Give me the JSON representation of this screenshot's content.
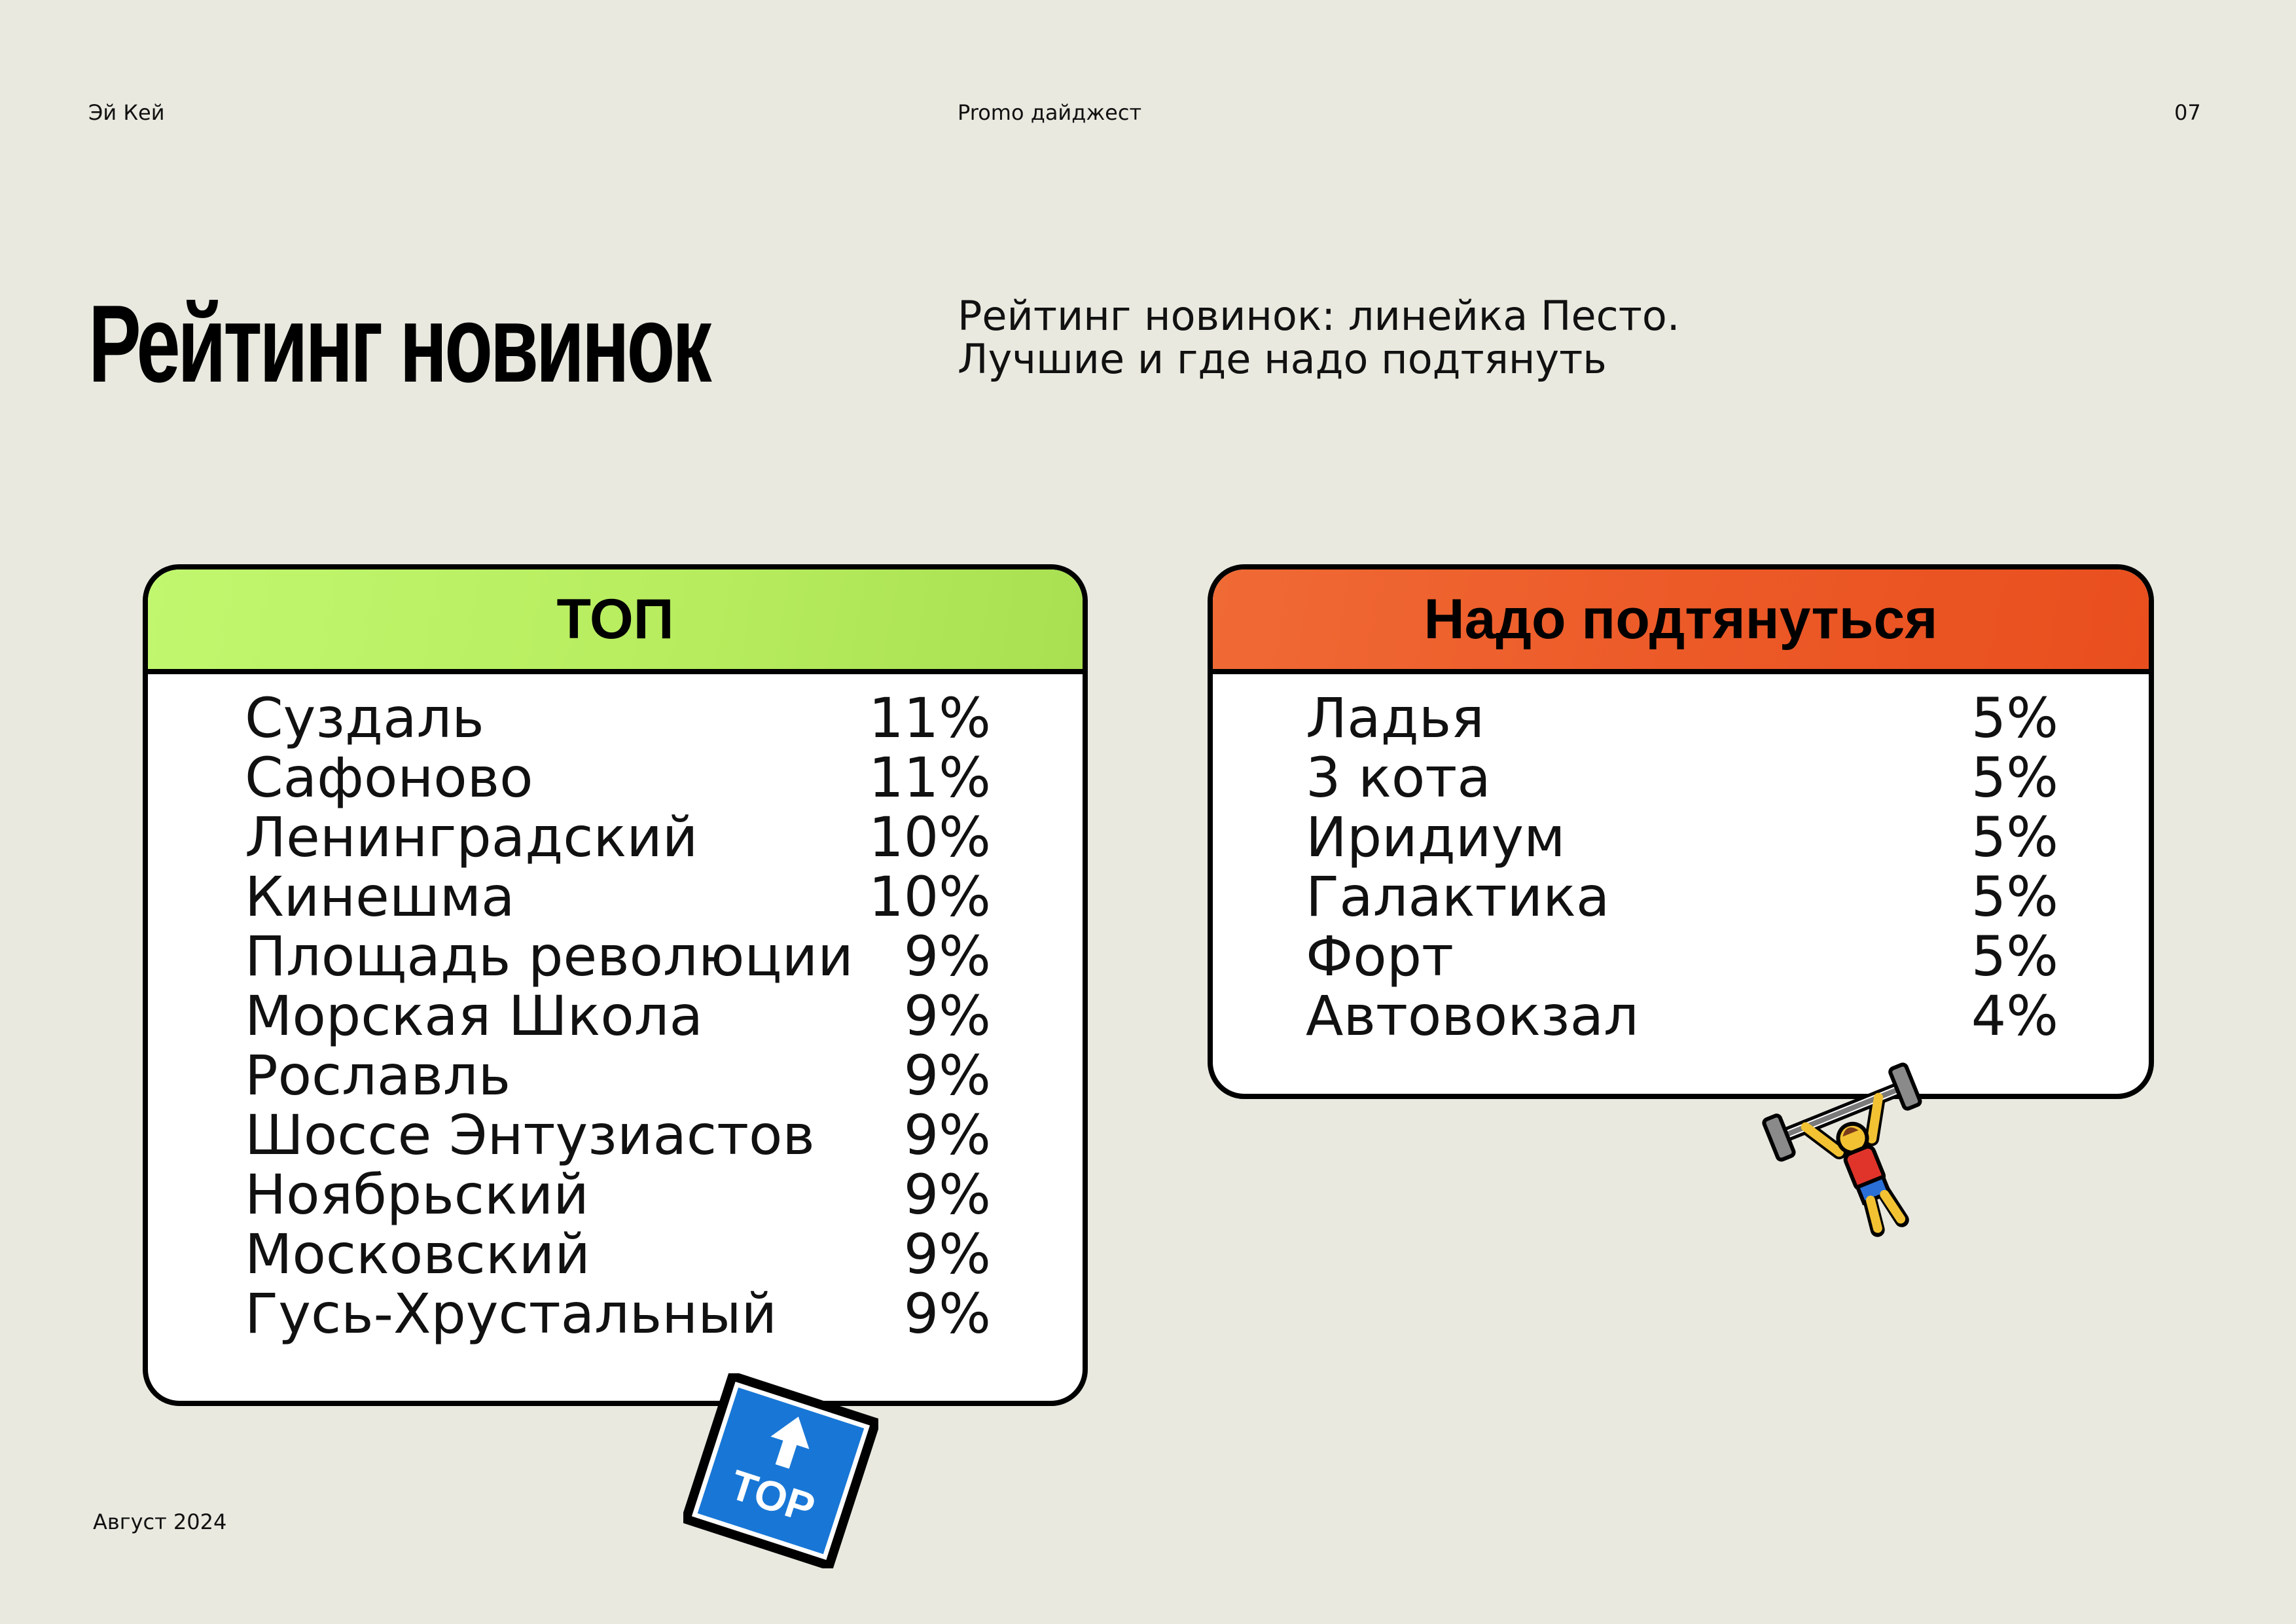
{
  "header": {
    "brand": "Эй Кей",
    "digest": "Promo дайджест",
    "page_number": "07"
  },
  "title": "Рейтинг новинок",
  "subtitle": {
    "line1": "Рейтинг новинок: линейка Песто.",
    "line2": "Лучшие и где надо подтянуть"
  },
  "top_card": {
    "heading": "ТОП",
    "color": "#b6ec5d",
    "rows": [
      {
        "name": "Суздаль",
        "value": "11%"
      },
      {
        "name": "Сафоново",
        "value": "11%"
      },
      {
        "name": "Ленинградский",
        "value": "10%"
      },
      {
        "name": "Кинешма",
        "value": "10%"
      },
      {
        "name": "Площадь революции",
        "value": "9%"
      },
      {
        "name": "Морская Школа",
        "value": "9%"
      },
      {
        "name": "Рославль",
        "value": "9%"
      },
      {
        "name": "Шоссе Энтузиастов",
        "value": "9%"
      },
      {
        "name": "Ноябрьский",
        "value": "9%"
      },
      {
        "name": "Московский",
        "value": "9%"
      },
      {
        "name": "Гусь-Хрустальный",
        "value": "9%"
      }
    ]
  },
  "weak_card": {
    "heading": "Надо подтянуться",
    "color": "#ec5a28",
    "rows": [
      {
        "name": "Ладья",
        "value": "5%"
      },
      {
        "name": "3 кота",
        "value": "5%"
      },
      {
        "name": "Иридиум",
        "value": "5%"
      },
      {
        "name": "Галактика",
        "value": "5%"
      },
      {
        "name": "Форт",
        "value": "5%"
      },
      {
        "name": "Автовокзал",
        "value": "4%"
      }
    ]
  },
  "stickers": {
    "top_badge": {
      "icon": "top-arrow-icon",
      "label": "TOP",
      "color": "#1877d6"
    },
    "lifter": {
      "icon": "weightlifter-icon"
    }
  },
  "footer": {
    "date": "Август 2024"
  }
}
